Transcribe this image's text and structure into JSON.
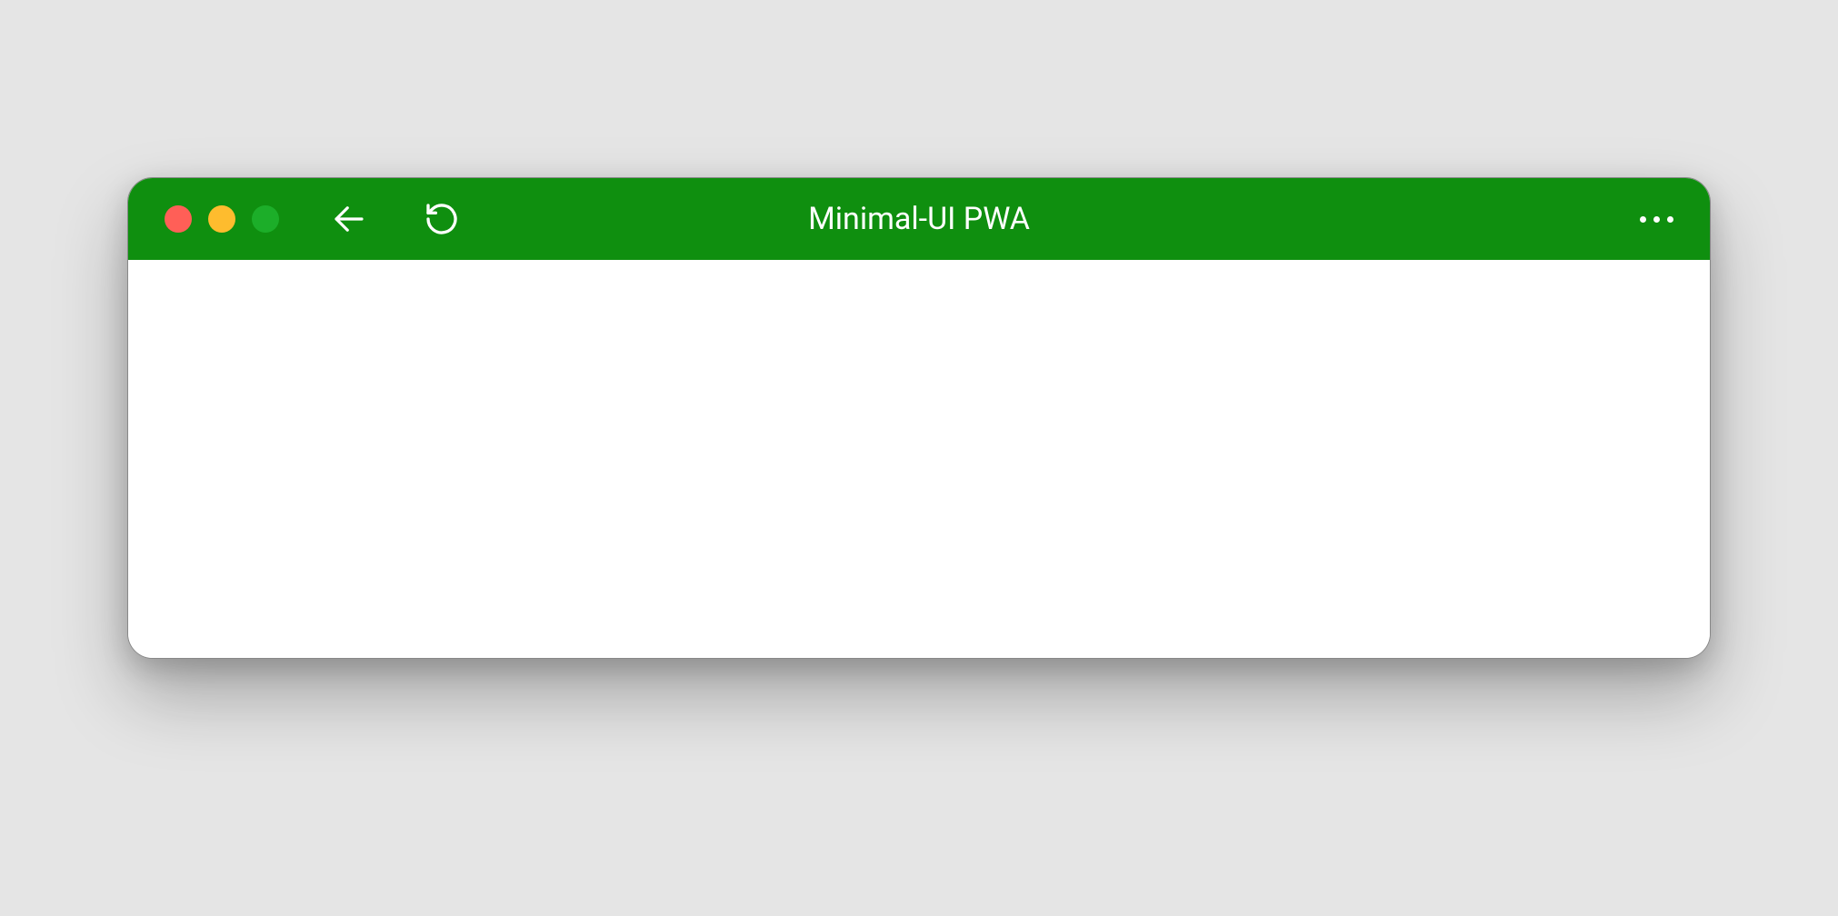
{
  "window": {
    "title": "Minimal-UI PWA"
  },
  "colors": {
    "titlebar_bg": "#0f8f0f",
    "content_bg": "#ffffff",
    "page_bg": "#e5e5e5",
    "traffic_close": "#ff5f57",
    "traffic_min": "#febc2e",
    "traffic_max": "#28c840"
  },
  "icons": {
    "back": "arrow-left-icon",
    "reload": "reload-icon",
    "more": "more-horizontal-icon"
  }
}
